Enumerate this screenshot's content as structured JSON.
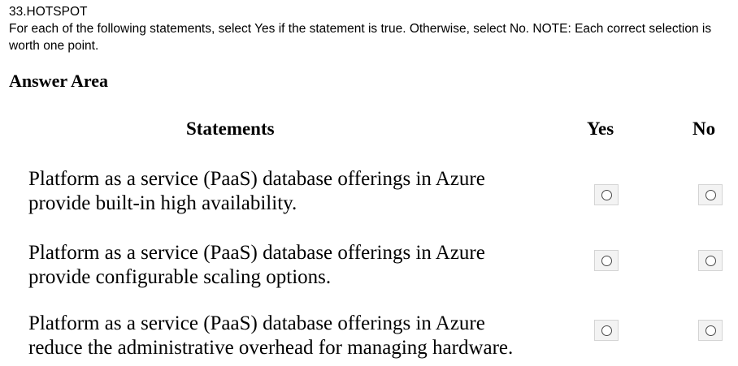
{
  "question": {
    "number": "33.HOTSPOT",
    "instructions": "For each of the following statements, select Yes if the statement is true. Otherwise, select No. NOTE: Each correct selection is worth one point."
  },
  "answer_area": {
    "title": "Answer Area",
    "headers": {
      "statements": "Statements",
      "yes": "Yes",
      "no": "No"
    },
    "rows": [
      {
        "statement": "Platform as a service (PaaS) database offerings in Azure\nprovide built-in high availability.",
        "yes_selected": false,
        "no_selected": false
      },
      {
        "statement": "Platform as a service (PaaS) database offerings in Azure\nprovide configurable scaling options.",
        "yes_selected": false,
        "no_selected": false
      },
      {
        "statement": "Platform as a service (PaaS) database offerings in Azure\nreduce the administrative overhead for managing hardware.",
        "yes_selected": false,
        "no_selected": false
      }
    ]
  }
}
